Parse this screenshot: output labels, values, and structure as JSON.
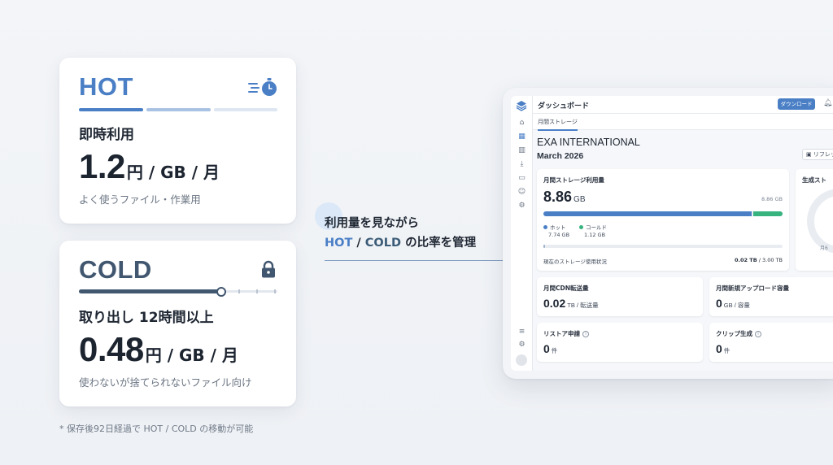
{
  "hot_card": {
    "title": "HOT",
    "subtitle": "即時利用",
    "price": "1.2",
    "unit": "円 / GB / 月",
    "description": "よく使うファイル・作業用",
    "icon": "stopwatch-fast-icon"
  },
  "cold_card": {
    "title": "COLD",
    "subtitle": "取り出し 12時間以上",
    "price": "0.48",
    "unit": "円 / GB / 月",
    "description": "使わないが捨てられないファイル向け",
    "icon": "lock-icon"
  },
  "footnote": "* 保存後92日経過で HOT / COLD の移動が可能",
  "callout": {
    "line1": "利用量を見ながら",
    "hot_word": "HOT",
    "slash": " / ",
    "cold_word": "COLD",
    "line2_rest": " の比率を管理"
  },
  "dashboard": {
    "title": "ダッシュボード",
    "download_button": "ダウンロード",
    "tab": "月間ストレージ",
    "company": "EXA INTERNATIONAL",
    "period": "March 2026",
    "refresh_button": "リフレッシュ",
    "storage": {
      "label": "月間ストレージ利用量",
      "value": "8.86",
      "unit": "GB",
      "total": "8.86 GB",
      "hot_label": "ホット",
      "hot_value": "7.74 GB",
      "cold_label": "コールド",
      "cold_value": "1.12 GB",
      "hot_fraction": 0.874,
      "usage_label": "現在のストレージ使用状況",
      "usage_value_bold": "0.02 TB",
      "usage_value_rest": " / 3.00 TB",
      "usage_fraction": 0.007
    },
    "gen_panel": {
      "label": "生成スト",
      "text": "月6"
    },
    "cdn": {
      "label": "月間CDN転送量",
      "value": "0.02",
      "unit": "TB / 転送量"
    },
    "upload": {
      "label": "月間新規アップロード容量",
      "value": "0",
      "unit": "GB / 容量"
    },
    "restore": {
      "label": "リストア申請",
      "value": "0",
      "unit": "件"
    },
    "clip": {
      "label": "クリップ生成",
      "value": "0",
      "unit": "件"
    }
  },
  "colors": {
    "hot": "#4a7fc6",
    "cold": "#41566f",
    "cold_bar": "#36b37e"
  }
}
